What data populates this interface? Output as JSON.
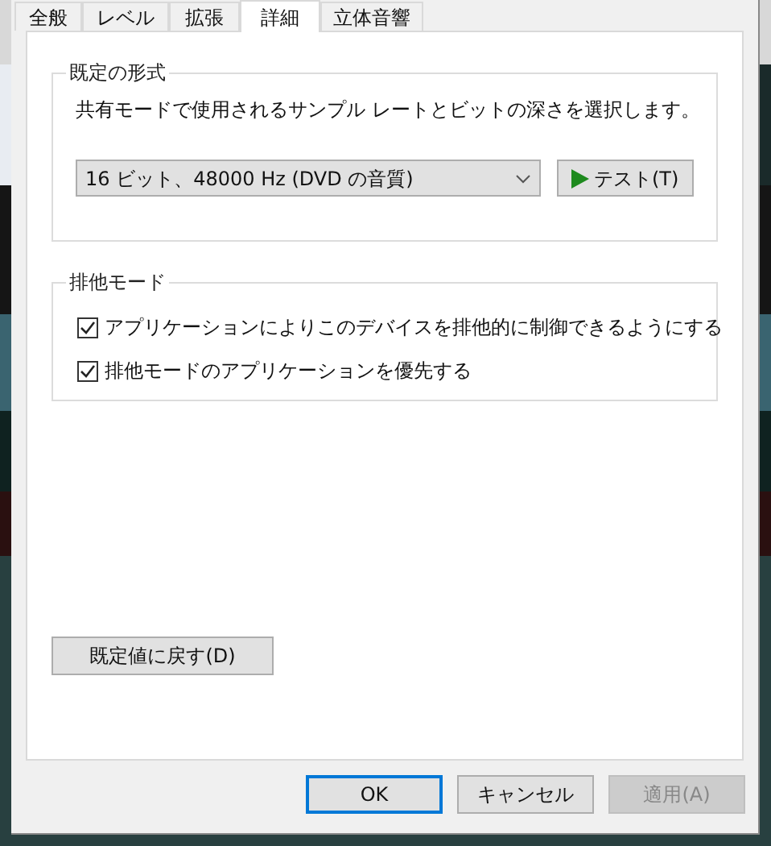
{
  "tabs": [
    {
      "label": "全般",
      "selected": false
    },
    {
      "label": "レベル",
      "selected": false
    },
    {
      "label": "拡張",
      "selected": false
    },
    {
      "label": "詳細",
      "selected": true
    },
    {
      "label": "立体音響",
      "selected": false
    }
  ],
  "default_format": {
    "title": "既定の形式",
    "description": "共有モードで使用されるサンプル レートとビットの深さを選択します。",
    "format_value": "16 ビット、48000 Hz (DVD の音質)",
    "test_button": "テスト(T)"
  },
  "exclusive_mode": {
    "title": "排他モード",
    "options": [
      {
        "label": "アプリケーションによりこのデバイスを排他的に制御できるようにする",
        "checked": true
      },
      {
        "label": "排他モードのアプリケーションを優先する",
        "checked": true
      }
    ]
  },
  "restore_button": "既定値に戻す(D)",
  "buttons": [
    {
      "label": "OK",
      "kind": "default",
      "disabled": false
    },
    {
      "label": "キャンセル",
      "kind": "normal",
      "disabled": false
    },
    {
      "label": "適用(A)",
      "kind": "normal",
      "disabled": true
    }
  ]
}
